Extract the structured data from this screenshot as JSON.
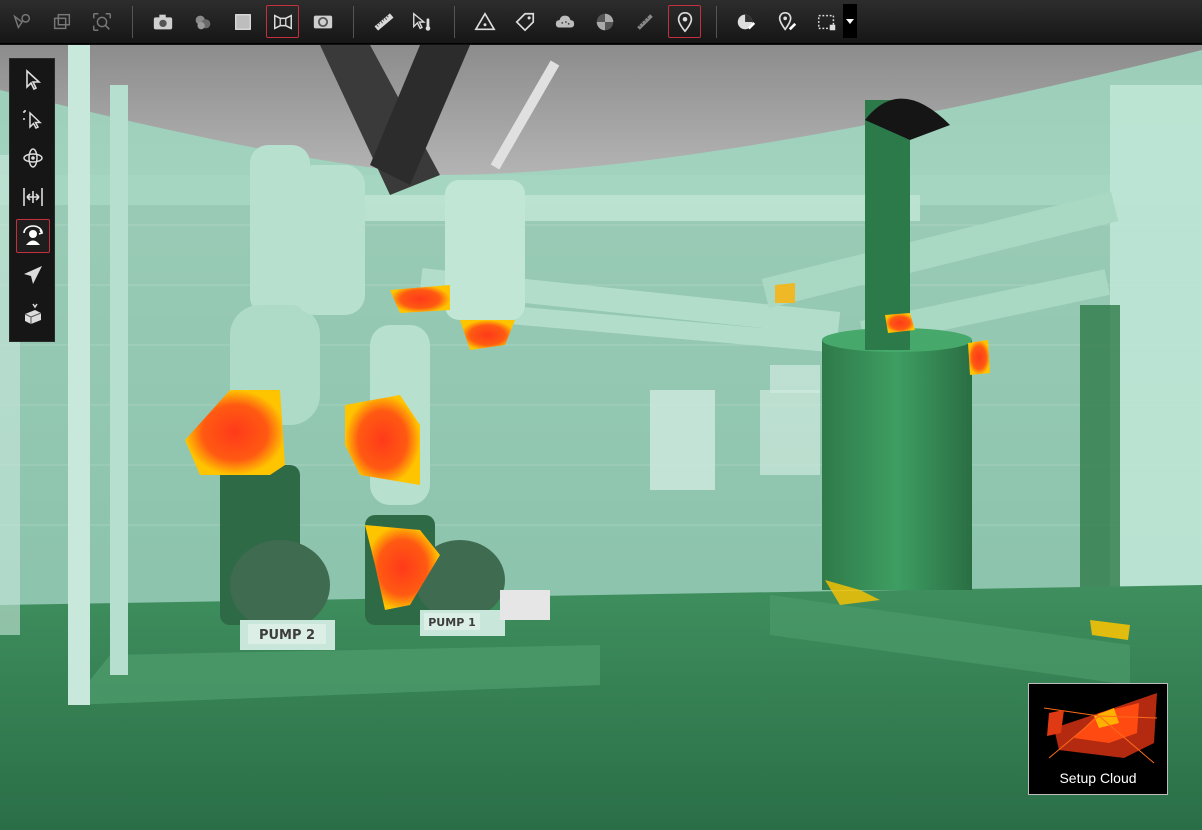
{
  "toolbar": {
    "groups": [
      [
        "select-area-icon",
        "copy-view-icon",
        "zoom-fit-icon"
      ],
      [
        "camera-icon",
        "layers-icon",
        "square-view-icon",
        "scan-view-icon",
        "panorama-icon"
      ],
      [
        "ruler-icon",
        "probe-icon"
      ],
      [
        "triangle-marker-icon",
        "tag-icon",
        "cloud-icon",
        "target-icon",
        "measure-line-icon",
        "location-pin-icon"
      ],
      [
        "pie-edit-icon",
        "pin-edit-icon",
        "selection-box-icon"
      ]
    ],
    "active_items": [
      "scan-view-icon",
      "location-pin-icon"
    ]
  },
  "sidebar": {
    "items": [
      "pointer-icon",
      "box-select-icon",
      "orbit-icon",
      "pan-icon",
      "walk-icon",
      "fly-icon",
      "clip-box-icon"
    ],
    "active_item": "walk-icon"
  },
  "viewport": {
    "labels": {
      "pump2": "PUMP 2",
      "pump1": "PUMP 1"
    },
    "colors": {
      "cloud_green": "#2e8a4f",
      "cloud_light": "#9fd8c0",
      "heat_hot": "#ff3a1a",
      "heat_warm": "#ffb000"
    }
  },
  "thumbnail": {
    "label": "Setup Cloud"
  }
}
